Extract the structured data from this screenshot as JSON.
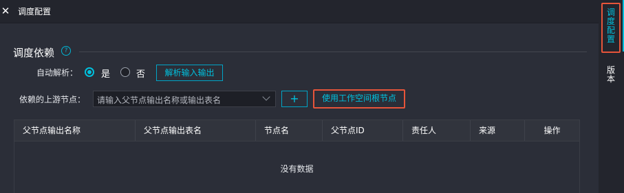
{
  "window": {
    "title": "调度配置",
    "close_icon": "close-icon"
  },
  "section": {
    "title": "调度依赖",
    "help_icon": "question-circle-icon"
  },
  "auto_parse": {
    "label": "自动解析：",
    "options": [
      "是",
      "否"
    ],
    "selected": "是",
    "parse_button": "解析输入输出"
  },
  "upstream": {
    "label": "依赖的上游节点：",
    "placeholder": "请输入父节点输出名称或输出表名",
    "add_button": "+",
    "root_button": "使用工作空间根节点"
  },
  "table": {
    "columns": [
      "父节点输出名称",
      "父节点输出表名",
      "节点名",
      "父节点ID",
      "责任人",
      "来源",
      "操作"
    ],
    "rows": [],
    "empty_text": "没有数据"
  },
  "side_tabs": [
    {
      "label": "调度配置",
      "active": true
    },
    {
      "label": "版本",
      "active": false
    }
  ],
  "colors": {
    "accent": "#00c1de",
    "highlight": "#e8553a",
    "background": "#2b2e38"
  }
}
